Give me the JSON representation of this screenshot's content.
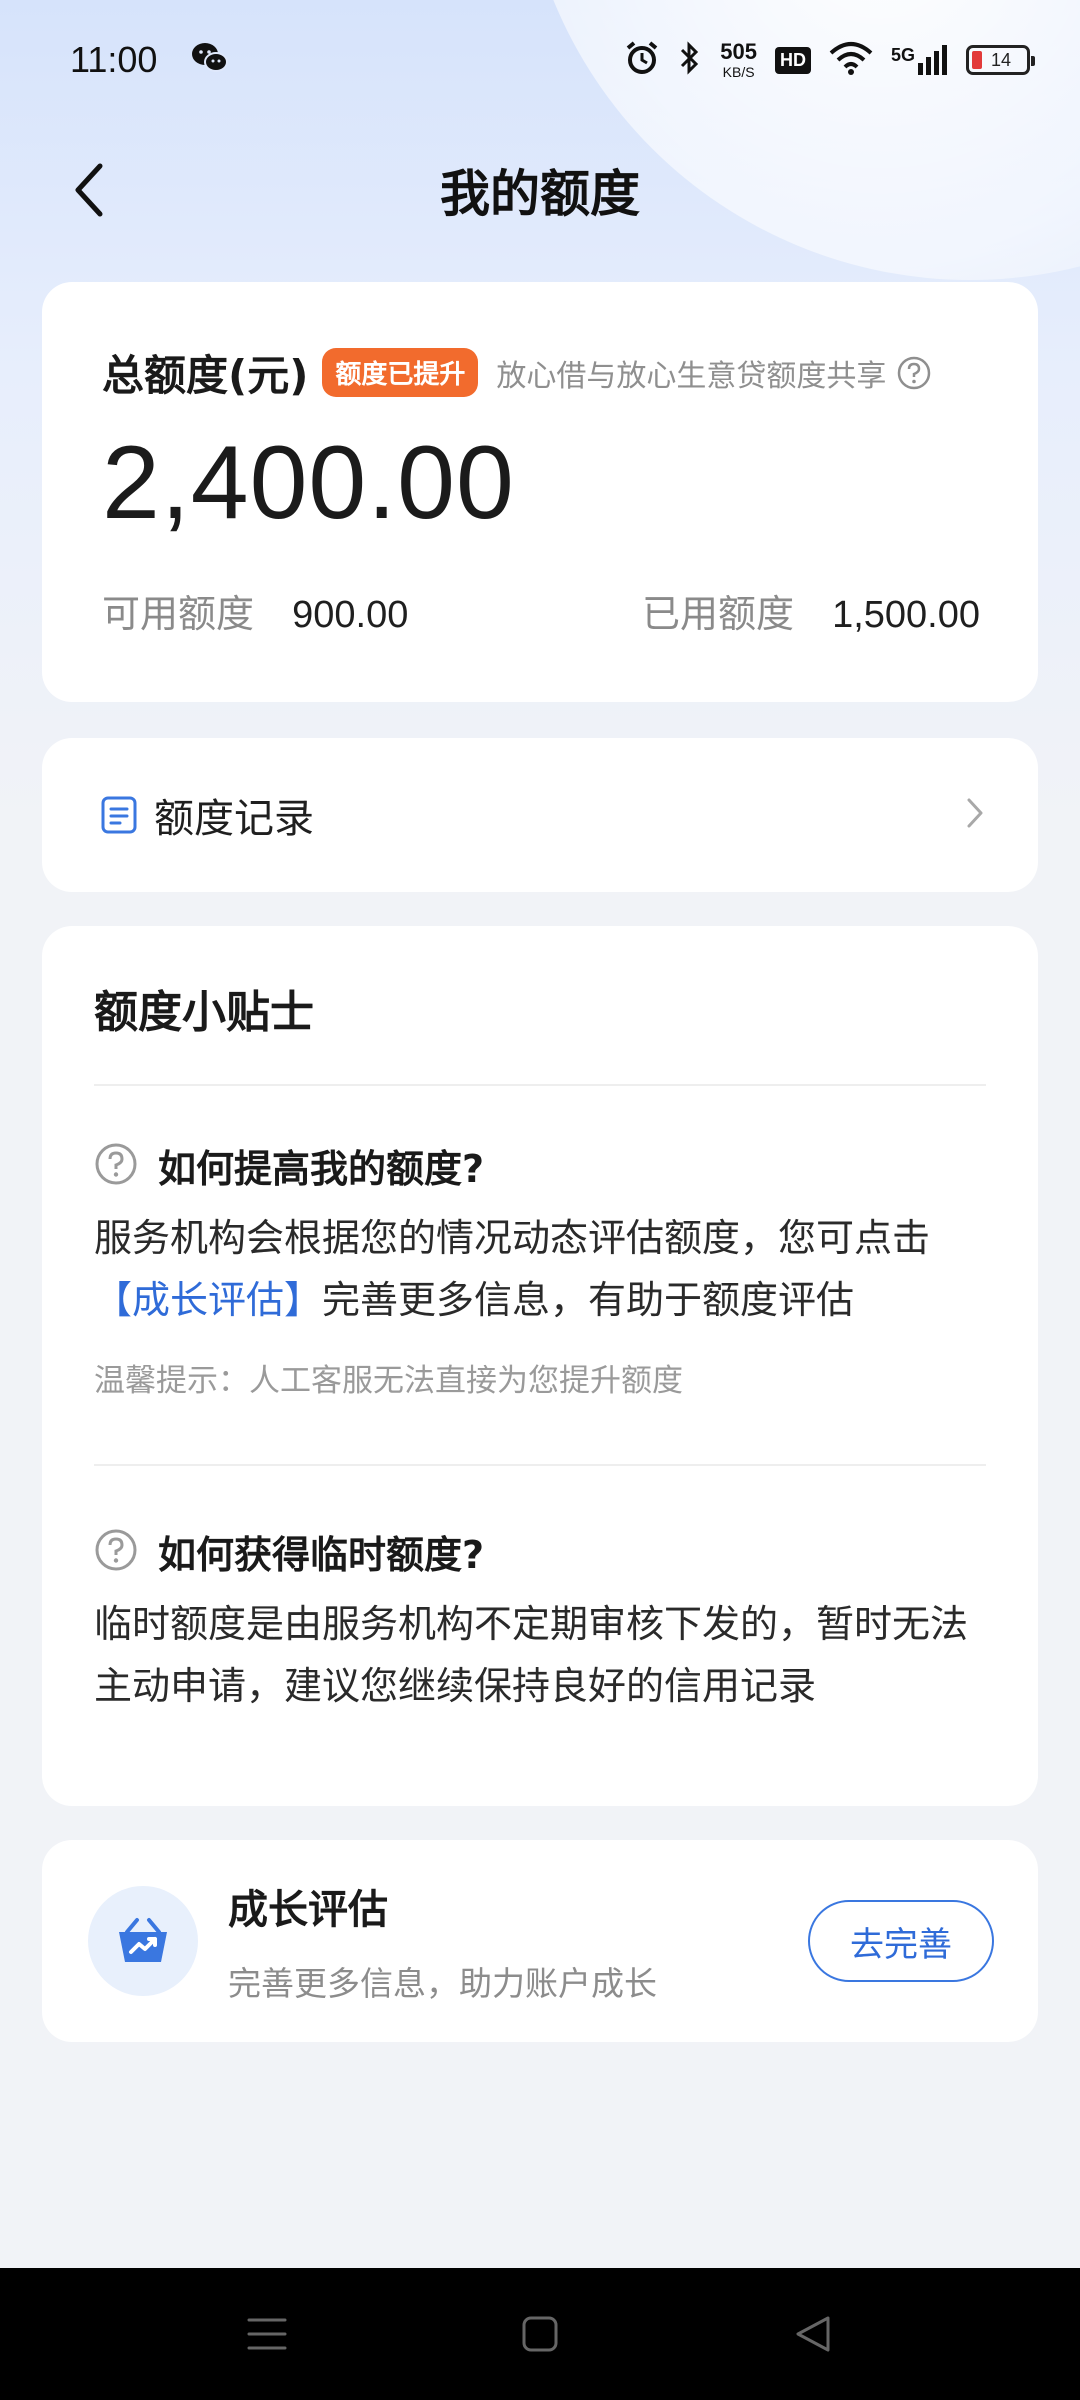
{
  "status_bar": {
    "time": "11:00",
    "net_speed_value": "505",
    "net_speed_unit": "KB/S",
    "hd_label": "HD",
    "signal_label": "5G",
    "battery_level": "14",
    "icons": [
      "wechat-icon",
      "alarm-icon",
      "bluetooth-icon",
      "wifi-icon",
      "signal-icon",
      "battery-icon"
    ]
  },
  "header": {
    "title": "我的额度"
  },
  "total": {
    "label": "总额度(元)",
    "badge": "额度已提升",
    "share_note": "放心借与放心生意贷额度共享",
    "amount": "2,400.00",
    "available_label": "可用额度",
    "available_value": "900.00",
    "used_label": "已用额度",
    "used_value": "1,500.00"
  },
  "record": {
    "label": "额度记录"
  },
  "tips": {
    "title": "额度小贴士",
    "q1": {
      "question": "如何提高我的额度?",
      "answer_before": "服务机构会根据您的情况动态评估额度，您可点击",
      "answer_link": "【成长评估】",
      "answer_after": "完善更多信息，有助于额度评估",
      "hint": "温馨提示：人工客服无法直接为您提升额度"
    },
    "q2": {
      "question": "如何获得临时额度?",
      "answer": "临时额度是由服务机构不定期审核下发的，暂时无法主动申请，建议您继续保持良好的信用记录"
    }
  },
  "growth": {
    "title": "成长评估",
    "subtitle": "完善更多信息，助力账户成长",
    "button": "去完善"
  },
  "colors": {
    "accent_blue": "#2f6bd8",
    "badge_orange": "#f26b2d"
  }
}
